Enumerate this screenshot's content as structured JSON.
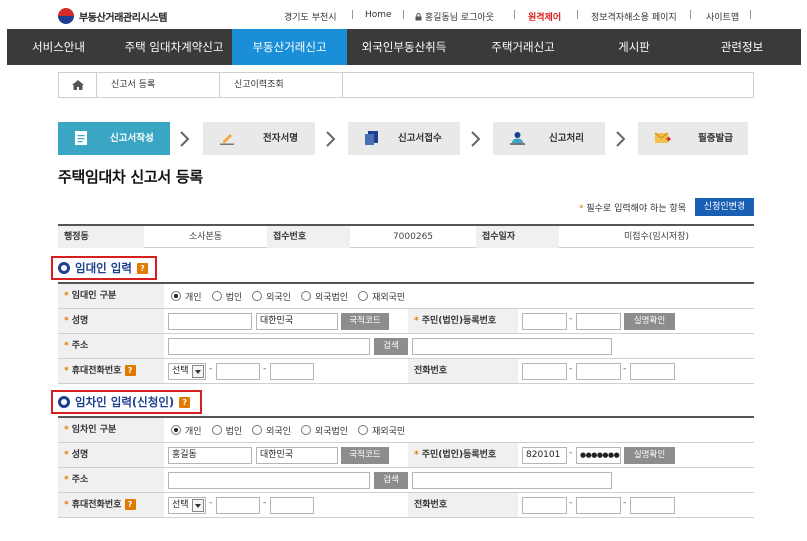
{
  "header": {
    "logo_text": "부동산거래관리시스템",
    "region": "경기도 부천시",
    "home": "Home",
    "user_logout": "홍길동님 로그아웃",
    "remote_control": "원격제어",
    "privacy_page": "정보격자해소용 페이지",
    "sitemap": "사이트맵"
  },
  "nav": [
    "서비스안내",
    "주택 임대차계약신고",
    "부동산거래신고",
    "외국인부동산취득",
    "주택거래신고",
    "게시판",
    "관련정보"
  ],
  "breadcrumb": [
    "신고서 등록",
    "신고이력조회"
  ],
  "steps": [
    "신고서작성",
    "전자서명",
    "신고서접수",
    "신고처리",
    "필증발급"
  ],
  "page_title": "주택임대차 신고서 등록",
  "required_note": "필수로 입력해야 하는 항목",
  "applicant_change_button": "신청인변경",
  "info": {
    "admin_label": "행정동",
    "admin_value": "소사본동",
    "receipt_no_label": "접수번호",
    "receipt_no_value": "7000265",
    "receipt_date_label": "접수일자",
    "receipt_date_value": "미접수(임시저장)"
  },
  "landlord": {
    "section_title": "임대인 입력",
    "type_label": "임대인 구분",
    "options": [
      "개인",
      "법인",
      "외국인",
      "외국법인",
      "재외국민"
    ],
    "selected": 0,
    "name_label": "성명",
    "name_value": "",
    "nationality_value": "대한민국",
    "nationality_button": "국적코드",
    "rrn_label": "주민(법인)등록번호",
    "rrn_front": "",
    "rrn_back": "",
    "verify_button": "실명확인",
    "address_label": "주소",
    "search_button": "검색",
    "mobile_label": "휴대전화번호",
    "mobile_select": "선택",
    "phone_label": "전화번호"
  },
  "tenant": {
    "section_title": "임차인 입력(신청인)",
    "type_label": "임차인 구분",
    "options": [
      "개인",
      "법인",
      "외국인",
      "외국법인",
      "재외국민"
    ],
    "selected": 0,
    "name_label": "성명",
    "name_value": "홍길동",
    "nationality_value": "대한민국",
    "nationality_button": "국적코드",
    "rrn_label": "주민(법인)등록번호",
    "rrn_front": "820101",
    "rrn_back": "●●●●●●●",
    "verify_button": "실명확인",
    "address_label": "주소",
    "search_button": "검색",
    "mobile_label": "휴대전화번호",
    "mobile_select": "선택",
    "phone_label": "전화번호"
  },
  "qmark": "?",
  "colors": {
    "nav_bg": "#3a3a3a",
    "nav_active": "#1a8fd8",
    "step_active": "#3aa6c4",
    "section_border": "#d62020",
    "section_title": "#1d3f8f",
    "required_star": "#e07a00",
    "remote_red": "#d81e1e"
  }
}
